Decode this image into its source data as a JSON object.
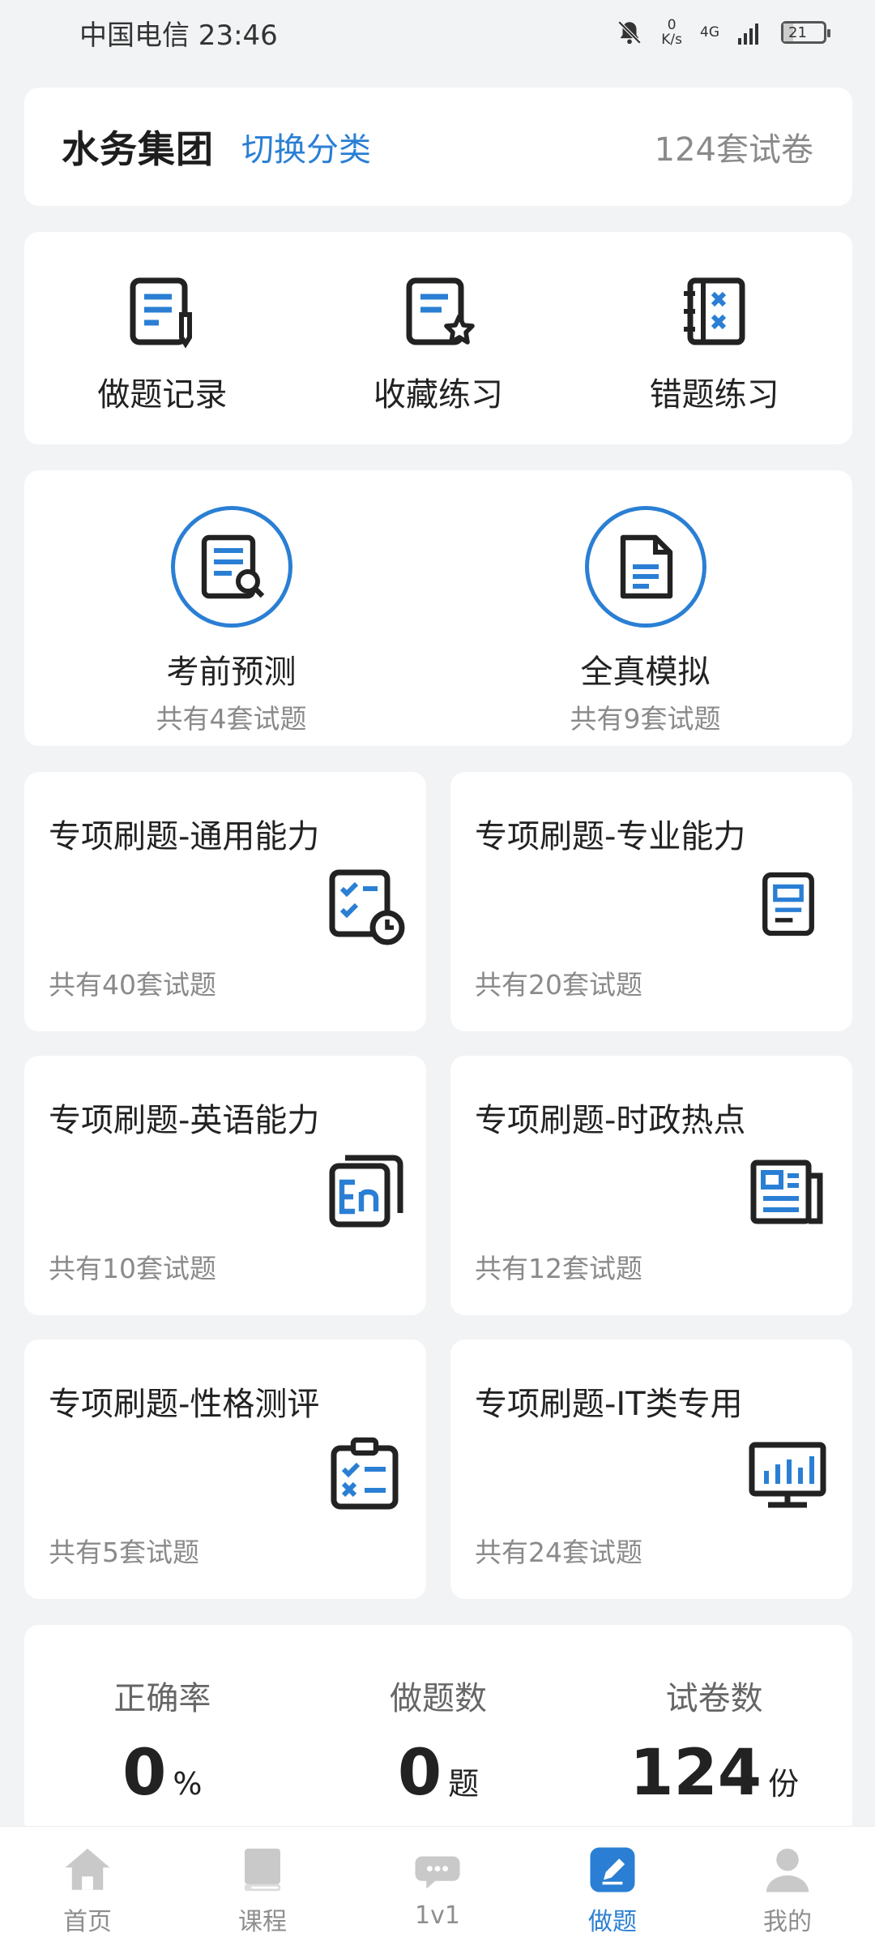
{
  "status_bar": {
    "carrier_time": "中国电信 23:46",
    "net_speed_value": "0",
    "net_speed_unit": "K/s",
    "network": "4G",
    "battery": "21"
  },
  "header": {
    "title": "水务集团",
    "switch_label": "切换分类",
    "paper_count": "124套试卷"
  },
  "quick_actions": [
    {
      "label": "做题记录",
      "icon": "edit-document-icon"
    },
    {
      "label": "收藏练习",
      "icon": "favorite-document-icon"
    },
    {
      "label": "错题练习",
      "icon": "wrong-notebook-icon"
    }
  ],
  "features": [
    {
      "title": "考前预测",
      "subtitle": "共有4套试题",
      "icon": "search-document-icon"
    },
    {
      "title": "全真模拟",
      "subtitle": "共有9套试题",
      "icon": "document-icon"
    }
  ],
  "topics": [
    {
      "title": "专项刷题-通用能力",
      "subtitle": "共有40套试题",
      "icon": "checklist-clock-icon"
    },
    {
      "title": "专项刷题-专业能力",
      "subtitle": "共有20套试题",
      "icon": "tablet-document-icon"
    },
    {
      "title": "专项刷题-英语能力",
      "subtitle": "共有10套试题",
      "icon": "english-icon"
    },
    {
      "title": "专项刷题-时政热点",
      "subtitle": "共有12套试题",
      "icon": "newspaper-icon"
    },
    {
      "title": "专项刷题-性格测评",
      "subtitle": "共有5套试题",
      "icon": "clipboard-check-icon"
    },
    {
      "title": "专项刷题-IT类专用",
      "subtitle": "共有24套试题",
      "icon": "monitor-chart-icon"
    }
  ],
  "stats": [
    {
      "label": "正确率",
      "value": "0",
      "unit": "%"
    },
    {
      "label": "做题数",
      "value": "0",
      "unit": "题"
    },
    {
      "label": "试卷数",
      "value": "124",
      "unit": "份"
    }
  ],
  "tabbar": [
    {
      "label": "首页",
      "icon": "home-icon",
      "active": false
    },
    {
      "label": "课程",
      "icon": "book-icon",
      "active": false
    },
    {
      "label": "1v1",
      "icon": "chat-icon",
      "active": false
    },
    {
      "label": "做题",
      "icon": "pencil-icon",
      "active": true
    },
    {
      "label": "我的",
      "icon": "user-icon",
      "active": false
    }
  ],
  "colors": {
    "accent": "#2a7fd4",
    "background": "#f2f3f5",
    "muted": "#8a8a8a"
  }
}
